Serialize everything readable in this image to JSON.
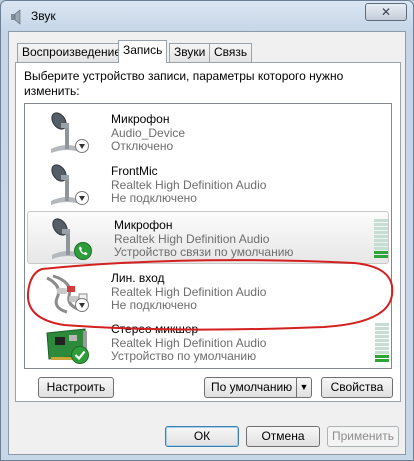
{
  "window": {
    "title": "Звук",
    "close_label": "✕"
  },
  "tabs": [
    {
      "label": "Воспроизведение",
      "active": false
    },
    {
      "label": "Запись",
      "active": true
    },
    {
      "label": "Звуки",
      "active": false
    },
    {
      "label": "Связь",
      "active": false
    }
  ],
  "panel": {
    "prompt": "Выберите устройство записи, параметры которого нужно изменить:"
  },
  "devices": [
    {
      "name": "Микрофон",
      "driver": "Audio_Device",
      "status": "Отключено",
      "badge": "down-arrow",
      "level": 0
    },
    {
      "name": "FrontMic",
      "driver": "Realtek High Definition Audio",
      "status": "Не подключено",
      "badge": "down-arrow",
      "level": 0
    },
    {
      "name": "Микрофон",
      "driver": "Realtek High Definition Audio",
      "status": "Устройство связи по умолчанию",
      "badge": "phone",
      "level": 0.2
    },
    {
      "name": "Лин. вход",
      "driver": "Realtek High Definition Audio",
      "status": "Не подключено",
      "badge": "down-arrow",
      "level": 0
    },
    {
      "name": "Стерео микшер",
      "driver": "Realtek High Definition Audio",
      "status": "Устройство по умолчанию",
      "badge": "check",
      "level": 0.2
    }
  ],
  "panel_buttons": {
    "configure": "Настроить",
    "set_default": "По умолчанию",
    "properties": "Свойства"
  },
  "dialog_buttons": {
    "ok": "ОК",
    "cancel": "Отмена",
    "apply": "Применить"
  },
  "colors": {
    "level_on": "#2fa43a",
    "level_off": "#c5ddd3",
    "annotation": "#d42020"
  }
}
